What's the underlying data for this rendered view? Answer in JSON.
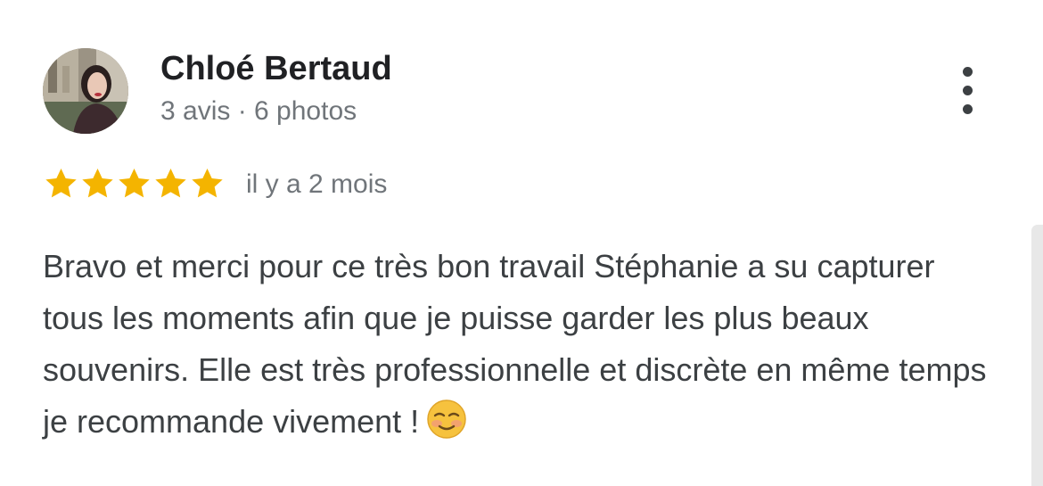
{
  "review": {
    "author": {
      "name": "Chloé Bertaud",
      "meta": "3 avis · 6 photos",
      "avatar_icon": "user-photo"
    },
    "rating": {
      "stars": 5,
      "max": 5,
      "star_color": "#f4b400"
    },
    "timestamp": "il y a 2 mois",
    "text": "Bravo et merci pour ce très bon travail Stéphanie a su capturer tous les moments afin que je puisse garder les plus beaux souvenirs. Elle est très professionnelle et discrète en même temps je recommande vivement !",
    "emoji_icon": "smiling-blushing-face-emoji",
    "more_menu_icon": "vertical-ellipsis-icon"
  }
}
